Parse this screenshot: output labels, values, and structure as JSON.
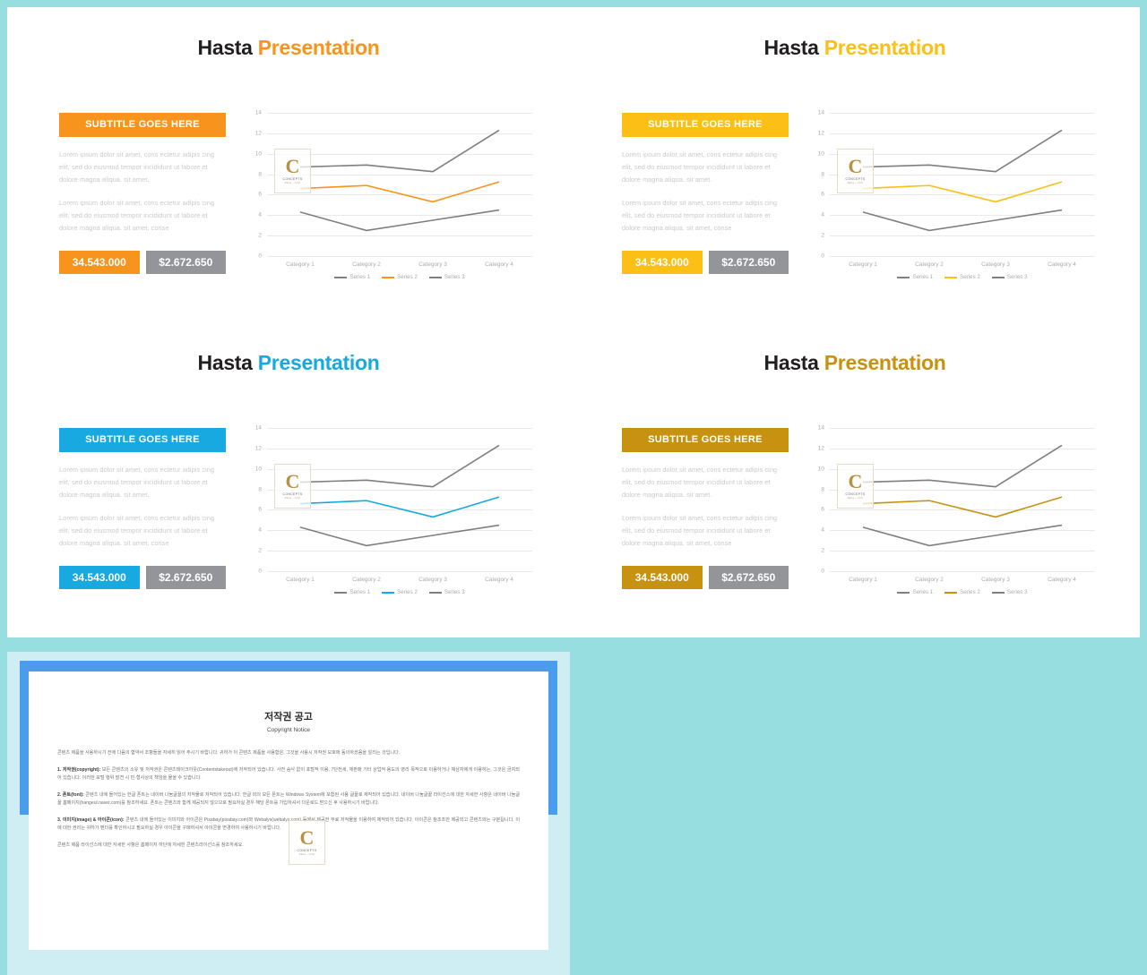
{
  "theme": {
    "page_background": "#96dee0",
    "slide_background": "#ffffff",
    "gray": "#939598",
    "title_dark": "#231f20",
    "body_text": "#c9cacb"
  },
  "slides": [
    {
      "id": "slide-orange",
      "accent": "#f7941e",
      "title_dark": "Hasta",
      "title_accent": "Presentation",
      "subtitle_bar": "SUBTITLE GOES HERE",
      "paragraph_1": "Lorem ipsum dolor sit amet, cons ectetur adipis cing elit, sed do eiusmod tempor incididunt ut labore et dolore magna aliqua. sit amet.",
      "paragraph_2": "Lorem ipsum dolor sit amet, cons ectetur adipis cing elit, sed do eiusmod tempor incididunt ut labore et dolore magna aliqua. sit amet, conse",
      "badge_primary": "34.543.000",
      "badge_secondary": "$2.672.650"
    },
    {
      "id": "slide-yellow",
      "accent": "#fbbf15",
      "title_dark": "Hasta",
      "title_accent": "Presentation",
      "subtitle_bar": "SUBTITLE GOES HERE",
      "paragraph_1": "Lorem ipsum dolor sit amet, cons ectetur adipis cing elit, sed do eiusmod tempor incididunt ut labore et dolore magna aliqua. sit amet.",
      "paragraph_2": "Lorem ipsum dolor sit amet, cons ectetur adipis cing elit, sed do eiusmod tempor incididunt ut labore et dolore magna aliqua. sit amet, conse",
      "badge_primary": "34.543.000",
      "badge_secondary": "$2.672.650"
    },
    {
      "id": "slide-blue",
      "accent": "#17a9e0",
      "title_dark": "Hasta",
      "title_accent": "Presentation",
      "subtitle_bar": "SUBTITLE GOES HERE",
      "paragraph_1": "Lorem ipsum dolor sit amet, cons ectetur adipis cing elit, sed do eiusmod tempor incididunt ut labore et dolore magna aliqua. sit amet.",
      "paragraph_2": "Lorem ipsum dolor sit amet, cons ectetur adipis cing elit, sed do eiusmod tempor incididunt ut labore et dolore magna aliqua. sit amet, conse",
      "badge_primary": "34.543.000",
      "badge_secondary": "$2.672.650"
    },
    {
      "id": "slide-gold",
      "accent": "#c89211",
      "title_dark": "Hasta",
      "title_accent": "Presentation",
      "subtitle_bar": "SUBTITLE GOES HERE",
      "paragraph_1": "Lorem ipsum dolor sit amet, cons ectetur adipis cing elit, sed do eiusmod tempor incididunt ut labore et dolore magna aliqua. sit amet.",
      "paragraph_2": "Lorem ipsum dolor sit amet, cons ectetur adipis cing elit, sed do eiusmod tempor incididunt ut labore et dolore magna aliqua. sit amet, conse",
      "badge_primary": "34.543.000",
      "badge_secondary": "$2.672.650"
    }
  ],
  "chart_data": {
    "type": "line",
    "title": "",
    "xlabel": "",
    "ylabel": "",
    "categories": [
      "Category 1",
      "Category 2",
      "Category 3",
      "Category 4"
    ],
    "ylim": [
      0,
      14
    ],
    "yticks": [
      0,
      2,
      4,
      6,
      8,
      10,
      12,
      14
    ],
    "grid": true,
    "legend_position": "bottom",
    "series": [
      {
        "name": "Series 1",
        "values": [
          8.7,
          8.9,
          8.25,
          12.3
        ],
        "color": "#7f7f7f"
      },
      {
        "name": "Series 2",
        "values": [
          6.6,
          6.9,
          5.3,
          7.25
        ],
        "color": "accent"
      },
      {
        "name": "Series 3",
        "values": [
          4.3,
          2.5,
          3.5,
          4.5
        ],
        "color": "#7f7f7f"
      }
    ]
  },
  "watermark": {
    "letter": "C",
    "line1": "CONCEPTS",
    "line2": "REAL . LIFE"
  },
  "copyright_slide": {
    "heading_ko": "저작권 공고",
    "heading_en": "Copyright Notice",
    "intro": "콘텐츠 제품을 사용하시기 전에 다음의 협약서 조항들을 자세히 읽어 주시기 바랍니다. 귀하가 이 콘텐츠 제품을 사용함은, 그것을 사용시 저작권 보호에 동의하셨음을 알리는 것입니다.",
    "sections": [
      {
        "label": "1. 저작권(copyright):",
        "text": " 모든 콘텐츠의 소유 및 저작권은 콘텐츠테이크아웃(Contentstakeout)에 저작되어 있습니다. 사전 승낙 없이 포털적 이용, 7단전세, 재판매 기타 상업적 용도의 영리 목적으로 이용하거나 제삼자에게 이용하는, 그것은 금지되어 있습니다. 이러한 포털 행위 발견 시 민·형사상의 책임을 물을 수 있습니다."
      },
      {
        "label": "2. 폰트(font):",
        "text": " 콘텐츠 내에 들어있는 한글 폰트는 네이버 나눔글꼴의 저작물로 저작되어 있습니다. 한글 외의 모든 폰트는 Windows System에 포함된 사용 글꼴로 제작되어 있습니다. 네이버 나눔글꼴 라이선스에 대한 자세한 사항은 네이버 나눔글꼴 홈페이지(hangeul.naver.com)를 참조하세요. 폰트는 콘텐츠와 함께 제공되지 않으므로 필요하실 경우 해당 폰트를 가입하셔서 다운로드 받으신 후 사용하시기 바랍니다."
      },
      {
        "label": "3. 이미지(image) & 아이콘(icon):",
        "text": " 콘텐츠 내에 들어있는 이미지와 아이콘은 Pixabay(pixabay.com)와 Webalys(webalys.com) 등에서 제공한 무료 저작물을 이용하여 제작되어 있습니다. 아이콘은 참조조만 제공되고 콘텐츠와는 구분됩니다. 이에 대한 권리는 귀하가 벤더를 확인하시고 필요하실 경우 아이콘을 구매하셔서 아이콘을 변경하여 사용하시기 바랍니다."
      }
    ],
    "footer": "콘텐츠 제품 라이선스에 대한 자세한 사항은 홈페이지 하단에 자세한 콘텐츠라이선스를 참조하세요."
  }
}
